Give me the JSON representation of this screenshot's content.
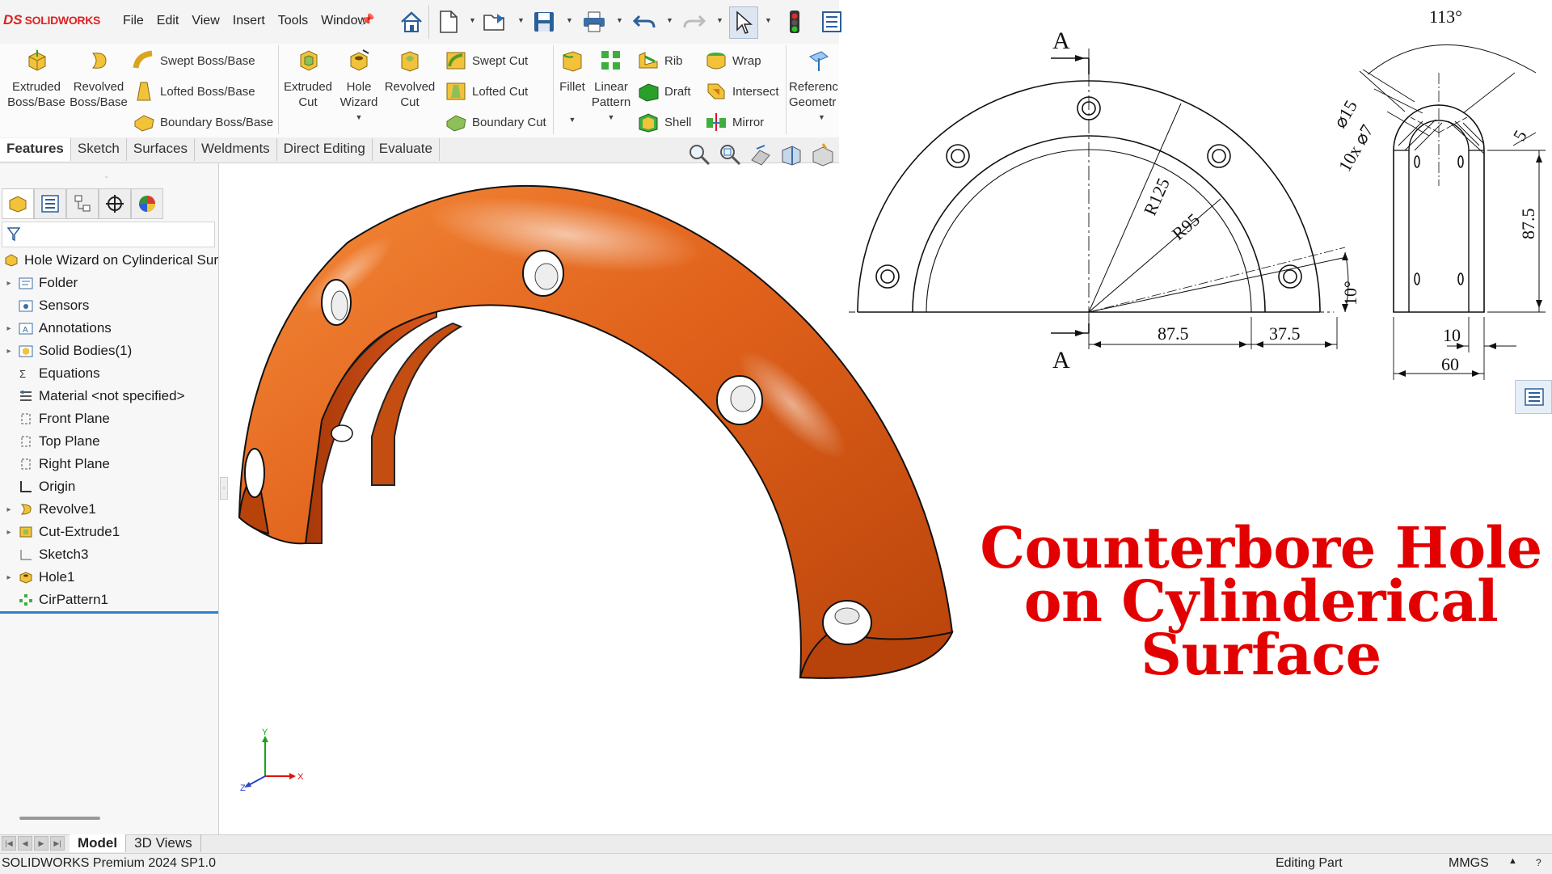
{
  "app": {
    "logo_text": "SOLIDWORKS",
    "logo_mark": "DS"
  },
  "menu": {
    "items": [
      "File",
      "Edit",
      "View",
      "Insert",
      "Tools",
      "Window"
    ]
  },
  "command_manager": {
    "extruded_boss": "Extruded\nBoss/Base",
    "revolved_boss": "Revolved\nBoss/Base",
    "swept_boss": "Swept Boss/Base",
    "lofted_boss": "Lofted Boss/Base",
    "boundary_boss": "Boundary Boss/Base",
    "extruded_cut": "Extruded\nCut",
    "hole_wizard": "Hole\nWizard",
    "revolved_cut": "Revolved\nCut",
    "swept_cut": "Swept Cut",
    "lofted_cut": "Lofted Cut",
    "boundary_cut": "Boundary Cut",
    "fillet": "Fillet",
    "linear_pattern": "Linear\nPattern",
    "rib": "Rib",
    "draft": "Draft",
    "shell": "Shell",
    "wrap": "Wrap",
    "intersect": "Intersect",
    "mirror": "Mirror",
    "reference_geometry": "Referenc\nGeometr"
  },
  "tabs": [
    {
      "label": "Features",
      "active": true
    },
    {
      "label": "Sketch",
      "active": false
    },
    {
      "label": "Surfaces",
      "active": false
    },
    {
      "label": "Weldments",
      "active": false
    },
    {
      "label": "Direct Editing",
      "active": false
    },
    {
      "label": "Evaluate",
      "active": false
    }
  ],
  "tree": {
    "root": "Hole Wizard on Cylinderical Sur",
    "items": [
      {
        "label": "Folder",
        "expandable": true,
        "icon": "folder-icon"
      },
      {
        "label": "Sensors",
        "expandable": false,
        "icon": "sensor-icon"
      },
      {
        "label": "Annotations",
        "expandable": true,
        "icon": "annotation-icon"
      },
      {
        "label": "Solid Bodies(1)",
        "expandable": true,
        "icon": "solid-bodies-icon"
      },
      {
        "label": "Equations",
        "expandable": false,
        "icon": "equations-icon"
      },
      {
        "label": "Material <not specified>",
        "expandable": false,
        "icon": "material-icon"
      },
      {
        "label": "Front Plane",
        "expandable": false,
        "icon": "plane-icon"
      },
      {
        "label": "Top Plane",
        "expandable": false,
        "icon": "plane-icon"
      },
      {
        "label": "Right Plane",
        "expandable": false,
        "icon": "plane-icon"
      },
      {
        "label": "Origin",
        "expandable": false,
        "icon": "origin-icon"
      },
      {
        "label": "Revolve1",
        "expandable": true,
        "icon": "revolve-icon"
      },
      {
        "label": "Cut-Extrude1",
        "expandable": true,
        "icon": "cut-extrude-icon"
      },
      {
        "label": "Sketch3",
        "expandable": false,
        "icon": "sketch-icon"
      },
      {
        "label": "Hole1",
        "expandable": true,
        "icon": "hole-icon"
      },
      {
        "label": "CirPattern1",
        "expandable": false,
        "icon": "circular-pattern-icon"
      }
    ]
  },
  "bottom_tabs": [
    {
      "label": "Model",
      "active": true
    },
    {
      "label": "3D Views",
      "active": false
    }
  ],
  "status": {
    "left": "SOLIDWORKS Premium 2024 SP1.0",
    "mode": "Editing Part",
    "units": "MMGS"
  },
  "drawing": {
    "section_label_top": "A",
    "section_label_bottom": "A",
    "r_outer": "R125",
    "r_inner": "R95",
    "angle_small": "10°",
    "dim_87_5": "87.5",
    "dim_37_5": "37.5",
    "angle_113": "113°",
    "dia_15": "⌀15",
    "holes": "10x ⌀7",
    "dim_5": "5",
    "dim_87_5_v": "87.5",
    "dim_10": "10",
    "dim_60": "60"
  },
  "triad": {
    "x": "X",
    "y": "Y",
    "z": "Z"
  },
  "headline": [
    "Counterbore Hole",
    "on Cylinderical",
    "Surface"
  ],
  "colors": {
    "part": "#e0621a",
    "headline": "#e30000",
    "brand": "#d22222",
    "selection": "#2f7fd0"
  }
}
